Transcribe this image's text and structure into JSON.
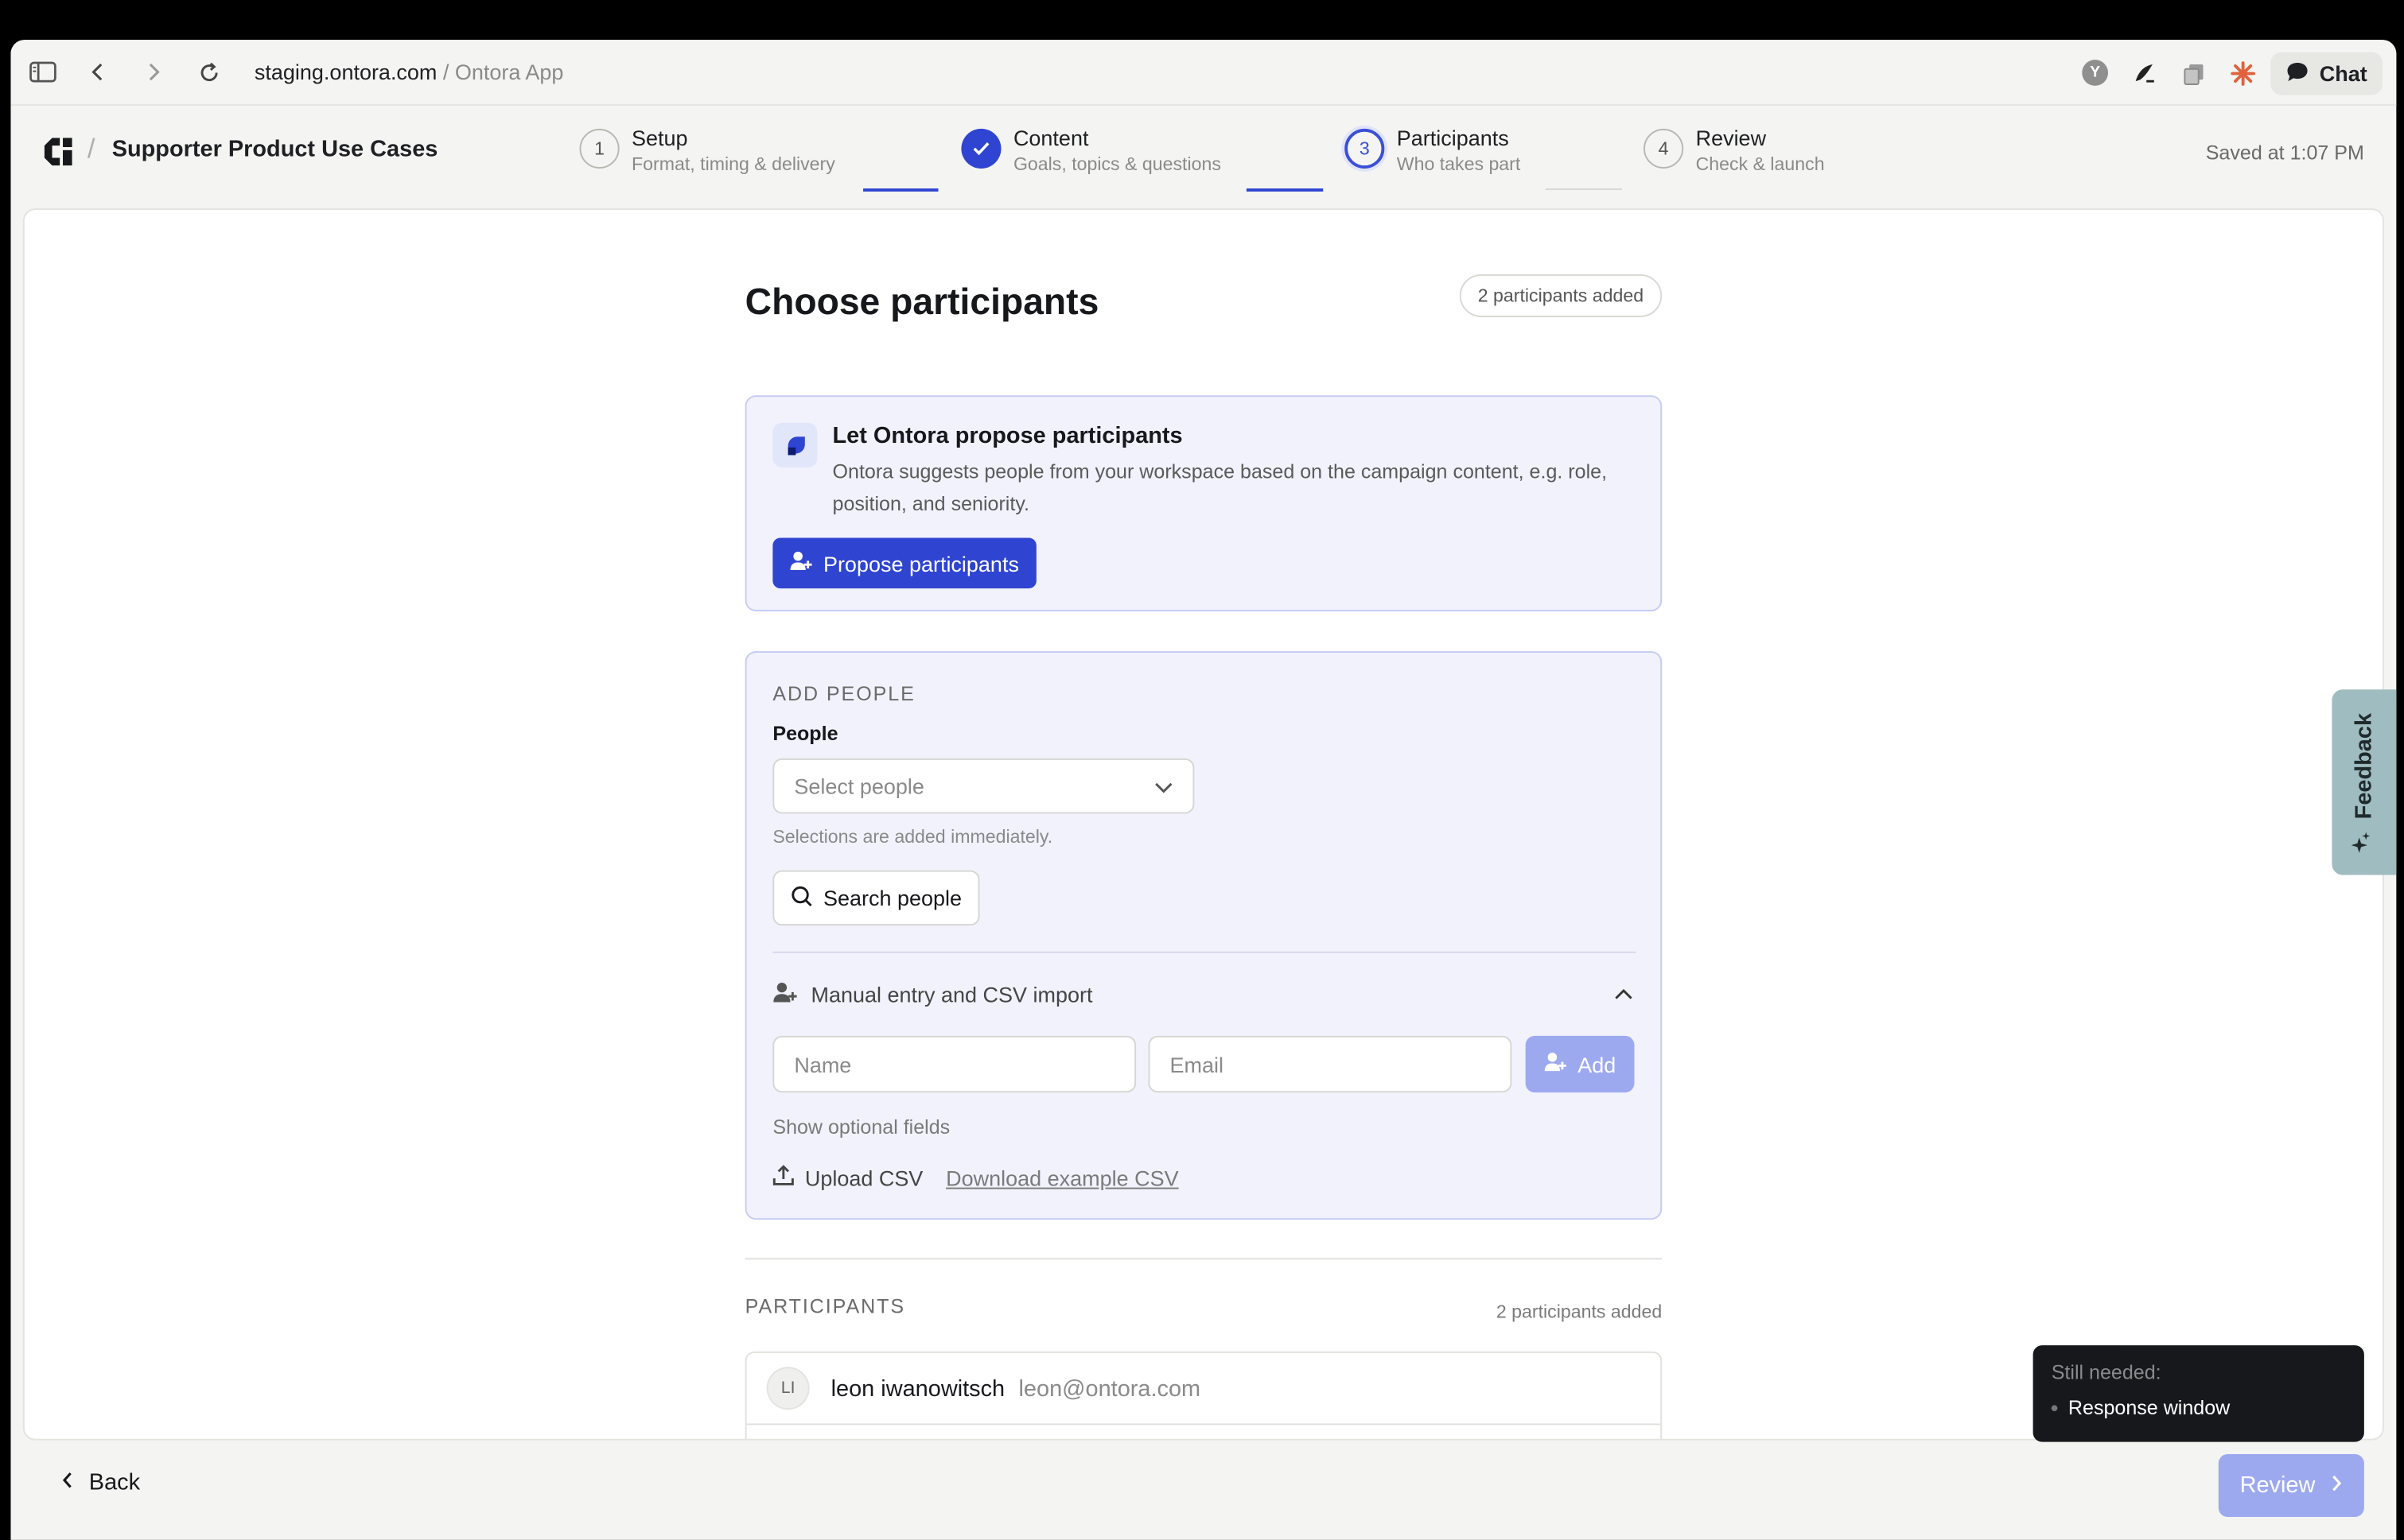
{
  "browser": {
    "url_host": "staging.ontora.com",
    "url_sep": " / ",
    "url_app": "Ontora App",
    "profile_initial": "Y",
    "chat_label": "Chat"
  },
  "header": {
    "project_title": "Supporter Product Use Cases",
    "steps": [
      {
        "number": "1",
        "title": "Setup",
        "subtitle": "Format, timing & delivery",
        "state": "upcoming"
      },
      {
        "number": "",
        "title": "Content",
        "subtitle": "Goals, topics & questions",
        "state": "done"
      },
      {
        "number": "3",
        "title": "Participants",
        "subtitle": "Who takes part",
        "state": "active"
      },
      {
        "number": "4",
        "title": "Review",
        "subtitle": "Check & launch",
        "state": "upcoming"
      }
    ],
    "saved_text": "Saved at 1:07 PM"
  },
  "main": {
    "title": "Choose participants",
    "count_pill": "2 participants added",
    "propose": {
      "title": "Let Ontora propose participants",
      "description": "Ontora suggests people from your workspace based on the campaign content, e.g. role, position, and seniority.",
      "button_label": "Propose participants"
    },
    "add_people": {
      "section_label": "ADD PEOPLE",
      "field_label": "People",
      "select_placeholder": "Select people",
      "hint": "Selections are added immediately.",
      "search_button": "Search people",
      "manual_label": "Manual entry and CSV import",
      "name_placeholder": "Name",
      "email_placeholder": "Email",
      "add_button": "Add",
      "optional_fields": "Show optional fields",
      "upload_csv": "Upload CSV",
      "download_csv": "Download example CSV"
    },
    "participants": {
      "section_label": "PARTICIPANTS",
      "count": "2 participants added",
      "rows": [
        {
          "initials": "LI",
          "name": "leon iwanowitsch",
          "email": "leon@ontora.com"
        }
      ]
    }
  },
  "feedback_tab": "Feedback",
  "footer": {
    "back_label": "Back",
    "review_label": "Review",
    "toast_title": "Still needed:",
    "toast_item": "Response window"
  },
  "colors": {
    "accent": "#2f45d1",
    "accent_disabled": "#9da9ef",
    "panel_bg": "#f1f2fc",
    "feedback_bg": "#9fbcc0"
  }
}
